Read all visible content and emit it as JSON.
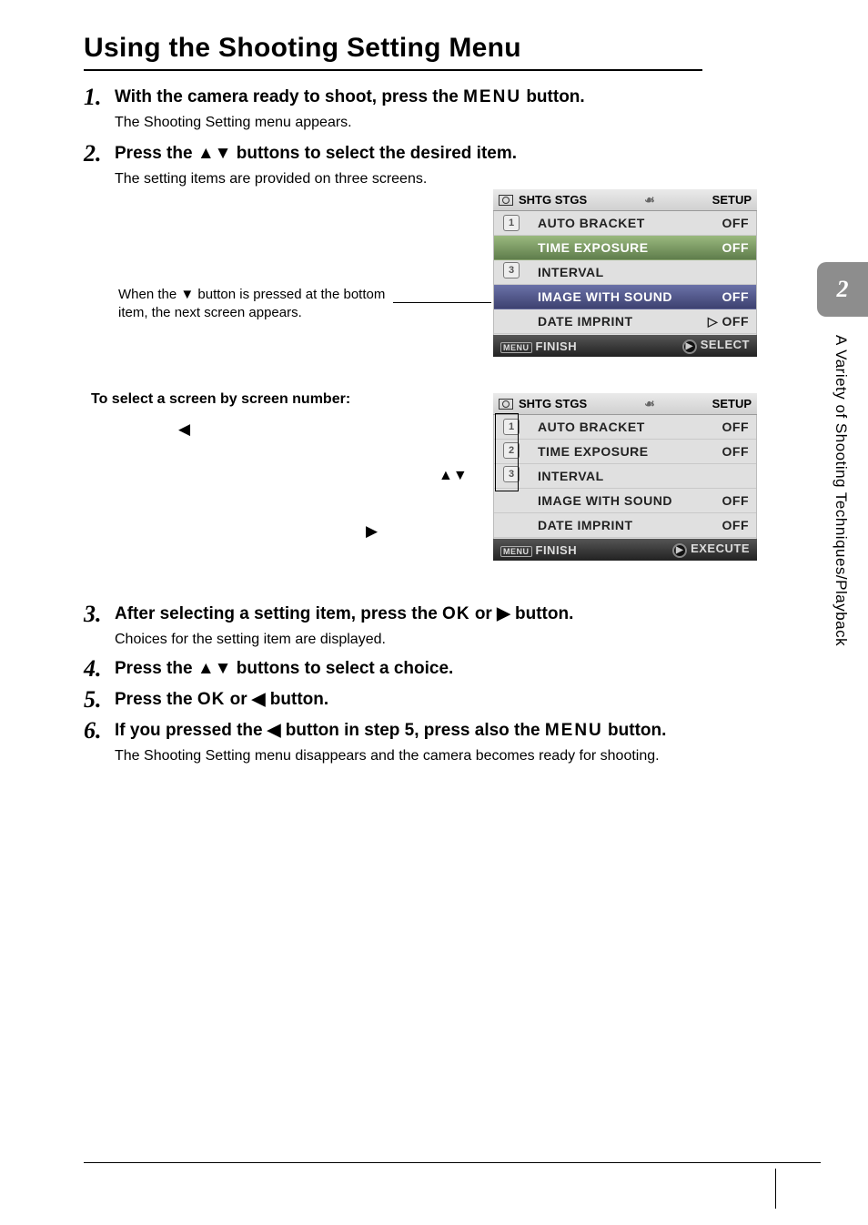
{
  "page_title": "Using the Shooting Setting Menu",
  "side_tab": "2",
  "side_text": "A Variety of Shooting Techniques/Playback",
  "steps": {
    "s1": {
      "num": "1.",
      "head_before": "With the camera ready to shoot, press the ",
      "head_glyph": "MENU",
      "head_after": " button.",
      "sub": "The Shooting Setting menu appears."
    },
    "s2": {
      "num": "2.",
      "head_before": "Press the ",
      "head_glyph": "▲▼",
      "head_after": " buttons to select the desired item.",
      "sub": "The setting items are provided on three screens."
    },
    "s3": {
      "num": "3.",
      "head_before": "After selecting a setting item, press the ",
      "head_glyph": "OK",
      "head_mid": " or ",
      "head_glyph2": "▶",
      "head_after": " button.",
      "sub": "Choices for the setting item are displayed."
    },
    "s4": {
      "num": "4.",
      "head_before": "Press the ",
      "head_glyph": "▲▼",
      "head_after": " buttons to select a choice."
    },
    "s5": {
      "num": "5.",
      "head_before": "Press the ",
      "head_glyph": "OK",
      "head_mid": " or ",
      "head_glyph2": "◀",
      "head_after": " button."
    },
    "s6": {
      "num": "6.",
      "head_before": "If you pressed the ",
      "head_glyph": "◀",
      "head_mid": " button in step 5, press also the ",
      "head_glyph2": "MENU",
      "head_after": " button.",
      "sub": "The Shooting Setting menu disappears and the camera becomes ready for shooting."
    }
  },
  "middle": {
    "note": "When the ▼ button is pressed at the bottom item, the next screen appears.",
    "sub_heading": "To select a screen by screen number:",
    "proc_left": "◀",
    "proc_mid": "▲▼",
    "proc_right": "▶"
  },
  "lcd1": {
    "tab1": "SHTG STGS",
    "tab3": "SETUP",
    "rows": [
      {
        "label": "AUTO BRACKET",
        "val": "OFF"
      },
      {
        "label": "TIME EXPOSURE",
        "val": "OFF"
      },
      {
        "label": "INTERVAL",
        "val": ""
      },
      {
        "label": "IMAGE WITH SOUND",
        "val": "OFF"
      },
      {
        "label": "DATE IMPRINT",
        "val": "▷ OFF"
      }
    ],
    "footer_left": "FINISH",
    "footer_right": "SELECT",
    "active_num": "2"
  },
  "lcd2": {
    "tab1": "SHTG STGS",
    "tab3": "SETUP",
    "rows": [
      {
        "label": "AUTO BRACKET",
        "val": "OFF"
      },
      {
        "label": "TIME EXPOSURE",
        "val": "OFF"
      },
      {
        "label": "INTERVAL",
        "val": ""
      },
      {
        "label": "IMAGE WITH SOUND",
        "val": "OFF"
      },
      {
        "label": "DATE IMPRINT",
        "val": "OFF"
      }
    ],
    "footer_left": "FINISH",
    "footer_right": "EXECUTE",
    "active_num": "1"
  }
}
